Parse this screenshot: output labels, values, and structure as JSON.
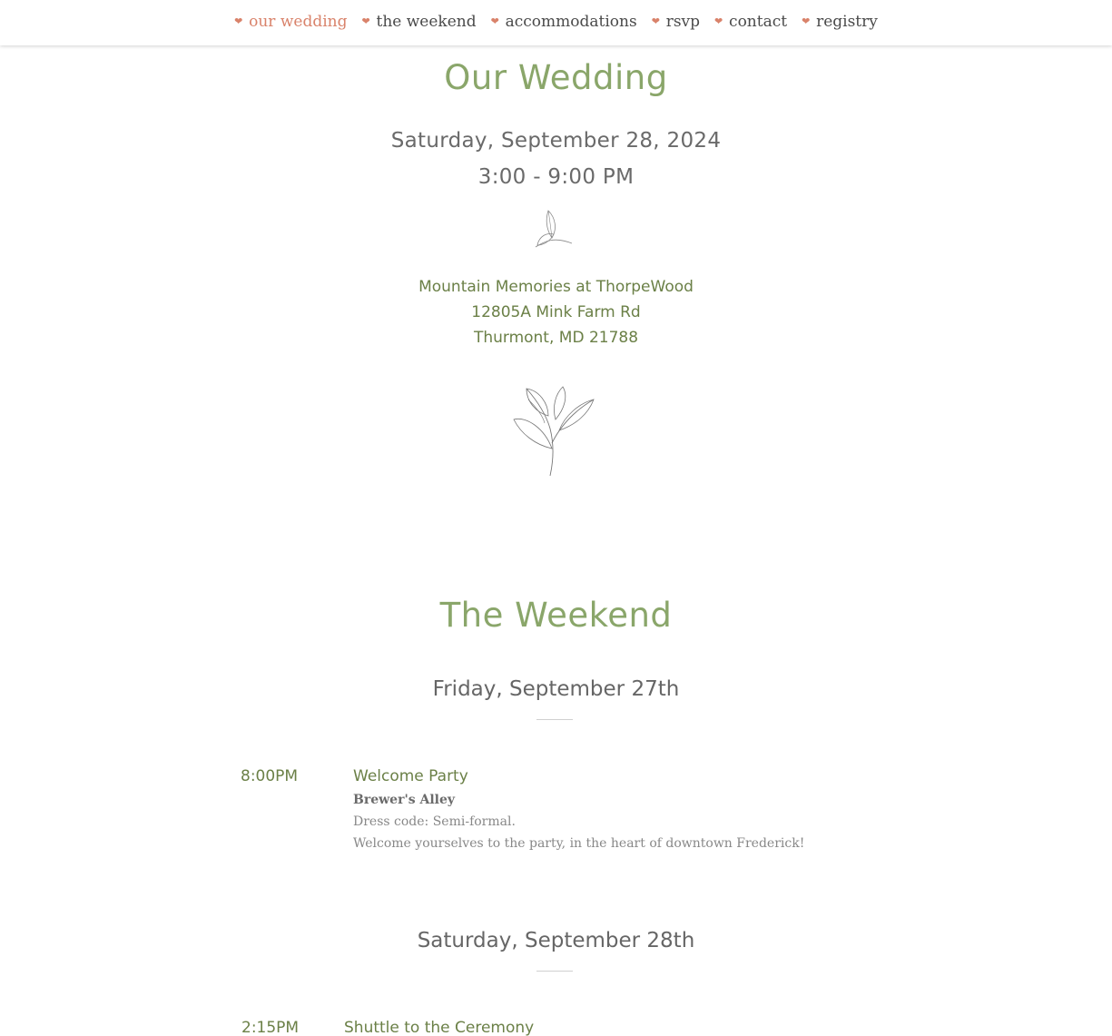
{
  "nav": {
    "items": [
      {
        "label": "our wedding",
        "active": true
      },
      {
        "label": "the weekend",
        "active": false
      },
      {
        "label": "accommodations",
        "active": false
      },
      {
        "label": "rsvp",
        "active": false
      },
      {
        "label": "contact",
        "active": false
      },
      {
        "label": "registry",
        "active": false
      }
    ]
  },
  "wedding": {
    "title": "Our Wedding",
    "date": "Saturday, September 28, 2024",
    "time": "3:00 - 9:00 PM",
    "venue": {
      "name": "Mountain Memories at ThorpeWood",
      "street": "12805A Mink Farm Rd",
      "city": "Thurmont, MD 21788"
    }
  },
  "weekend": {
    "title": "The Weekend",
    "days": [
      {
        "title": "Friday, September 27th",
        "events": [
          {
            "time": "8:00PM",
            "name": "Welcome Party",
            "place": "Brewer's Alley",
            "dress": "Dress code: Semi-formal.",
            "note": "Welcome yourselves to the party, in the heart of downtown Frederick!"
          }
        ]
      },
      {
        "title": "Saturday, September 28th",
        "events": [
          {
            "time": "2:15PM",
            "name": "Shuttle to the Ceremony"
          }
        ]
      }
    ]
  },
  "colors": {
    "accent_green": "#8aa66a",
    "text_green": "#6b8047",
    "nav_active": "#d9826a"
  },
  "icons": [
    "heart-icon",
    "small-leaf-icon",
    "leaf-branch-icon"
  ]
}
